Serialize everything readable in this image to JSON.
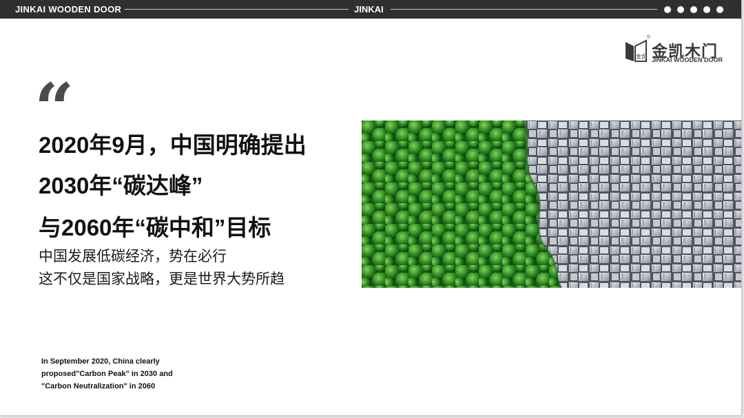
{
  "header": {
    "brand": "JINKAI WOODEN DOOR",
    "center": "JINKAI",
    "dots_count": 5
  },
  "logo": {
    "cn": "金凯木门",
    "en": "JINKAI WOODEN DOOR",
    "mark_text": "金凯",
    "reg": "®"
  },
  "quote_mark": "“",
  "headline": [
    "2020年9月，中国明确提出",
    "2030年“碳达峰”",
    "与2060年“碳中和”目标"
  ],
  "subtitle": [
    "中国发展低碳经济，势在必行",
    "这不仅是国家战略，更是世界大势所趋"
  ],
  "english": [
    "In September 2020, China clearly",
    "proposed\"Carbon Peak\" in 2030 and",
    " \"Carbon Neutralization\" in 2060"
  ],
  "colors": {
    "topbar": "#2f2f2f",
    "forest": "#2f8a22",
    "city": "#b9bfc6"
  }
}
